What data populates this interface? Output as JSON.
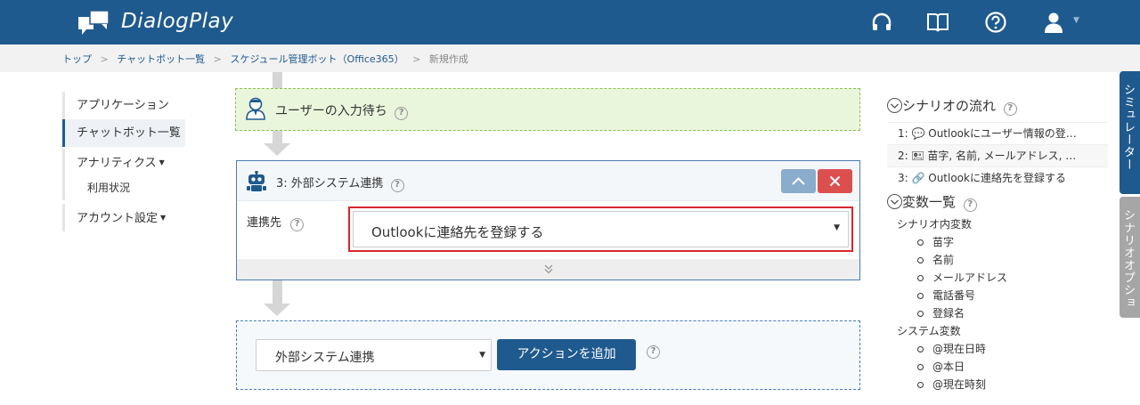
{
  "header": {
    "brand": "DialogPlay",
    "icons": [
      "headset-icon",
      "book-icon",
      "help-icon",
      "user-icon"
    ],
    "bg_color": "#1f5a8e"
  },
  "breadcrumb": {
    "items": [
      "トップ",
      "チャットボット一覧",
      "スケジュール管理ボット（Office365）",
      "新規作成"
    ],
    "sep": ">"
  },
  "nav": {
    "app": "アプリケーション",
    "chatbots": "チャットボット一覧",
    "analytics": "アナリティクス",
    "usage": "利用状況",
    "account": "アカウント設定"
  },
  "flow": {
    "wait_label": "ユーザーの入力待ち",
    "ext_title": "3: 外部システム連携",
    "target_label": "連携先",
    "target_value": "Outlookに連絡先を登録する",
    "add_select_value": "外部システム連携",
    "add_button": "アクションを追加"
  },
  "right_panel": {
    "flow_title": "シナリオの流れ",
    "flow_items": [
      "1: 💬 Outlookにユーザー情報の登…",
      "2: 🖭 苗字, 名前, メールアドレス, …",
      "3: 🔗 Outlookに連絡先を登録する"
    ],
    "vars_title": "変数一覧",
    "scenario_vars_label": "シナリオ内変数",
    "scenario_vars": [
      "苗字",
      "名前",
      "メールアドレス",
      "電話番号",
      "登録名"
    ],
    "system_vars_label": "システム変数",
    "system_vars": [
      "@現在日時",
      "@本日",
      "@現在時刻"
    ]
  },
  "side_tabs": {
    "simulator": "シミュレーター",
    "options": "シナリオオプション"
  },
  "colors": {
    "primary": "#1f5a8e",
    "danger": "#dc4f4f",
    "highlight": "#d9262e"
  }
}
